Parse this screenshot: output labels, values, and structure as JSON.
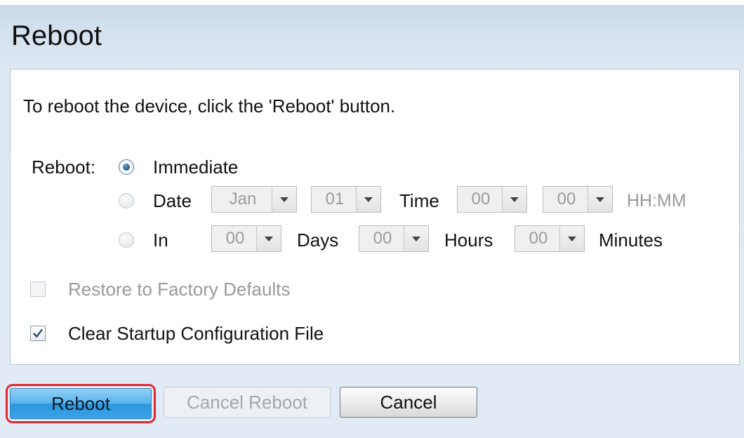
{
  "page": {
    "title": "Reboot",
    "instruction": "To reboot the device, click the 'Reboot' button."
  },
  "reboot_options": {
    "label": "Reboot:",
    "immediate": {
      "label": "Immediate",
      "selected": true
    },
    "date": {
      "label": "Date",
      "month": "Jan",
      "day": "01",
      "time_label": "Time",
      "hour": "00",
      "minute": "00",
      "format_hint": "HH:MM",
      "selected": false
    },
    "in": {
      "label": "In",
      "days": "00",
      "days_label": "Days",
      "hours": "00",
      "hours_label": "Hours",
      "minutes": "00",
      "minutes_label": "Minutes",
      "selected": false
    }
  },
  "checkboxes": {
    "restore_defaults": {
      "label": "Restore to Factory Defaults",
      "checked": false,
      "disabled": true
    },
    "clear_startup": {
      "label": "Clear Startup Configuration File",
      "checked": true,
      "disabled": false
    }
  },
  "buttons": {
    "reboot": "Reboot",
    "cancel_reboot": "Cancel Reboot",
    "cancel": "Cancel"
  },
  "colors": {
    "highlight": "#e02a33",
    "primary_button": "#3aa4e6",
    "background": "#dde8f3"
  }
}
